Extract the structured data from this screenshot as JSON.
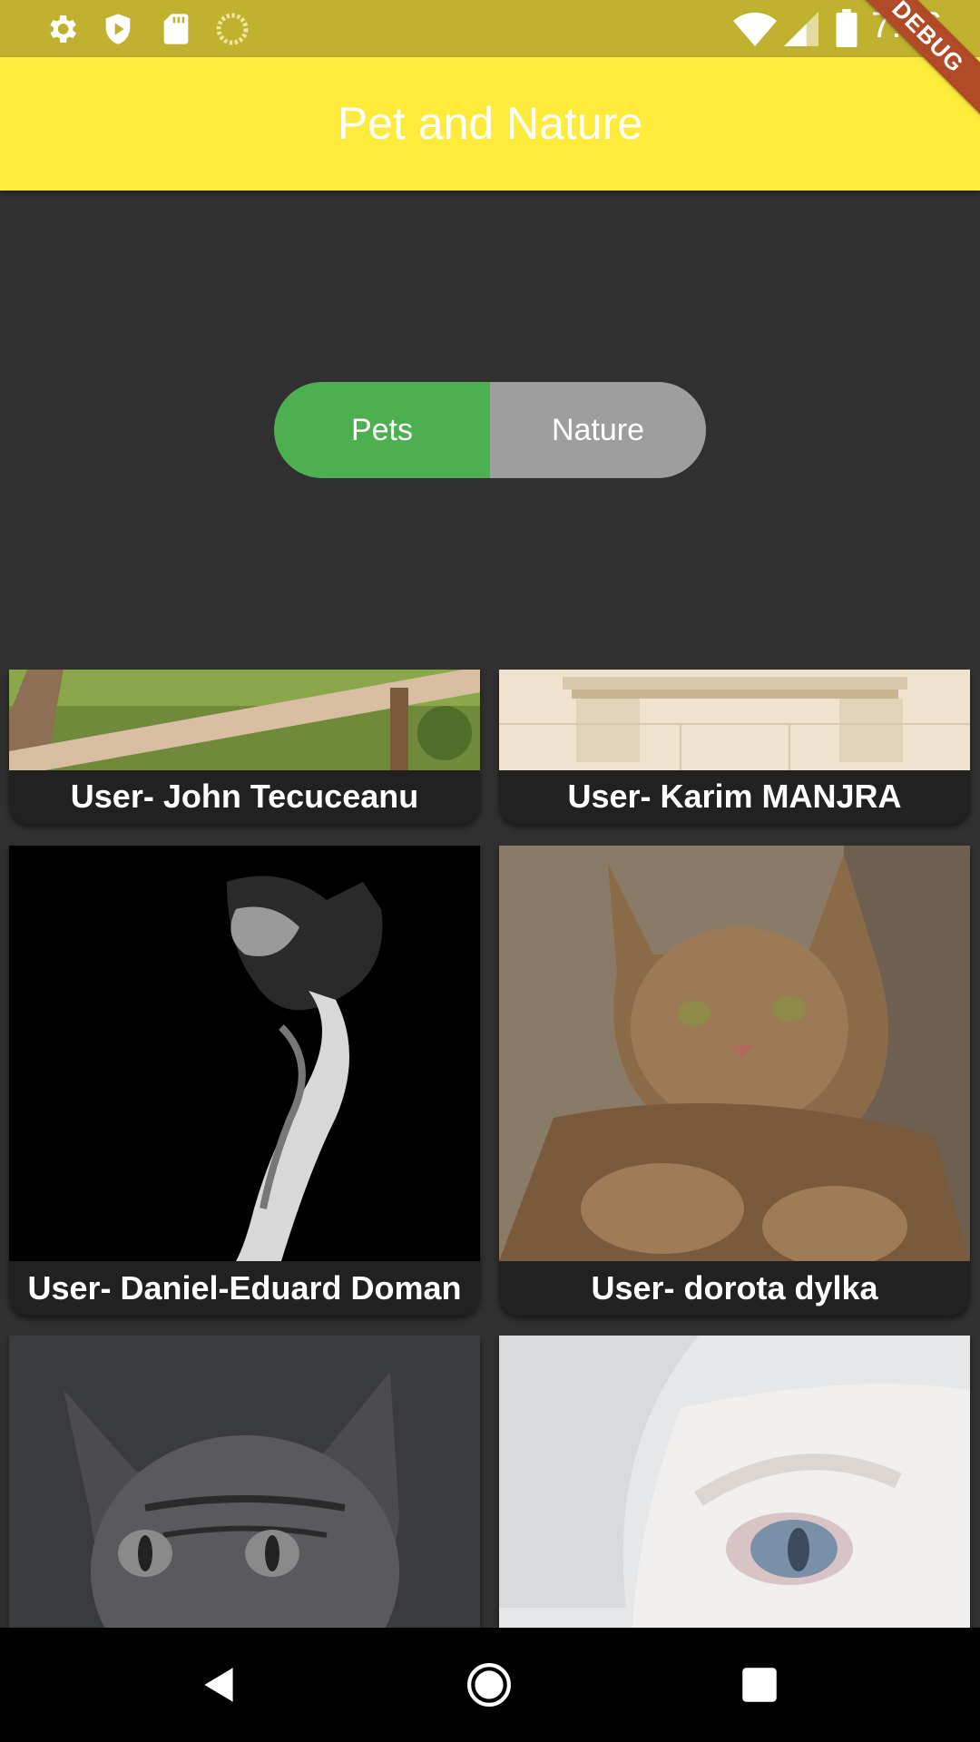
{
  "status_bar": {
    "time": "7:06",
    "left_icons": [
      "gear-icon",
      "shield-icon",
      "sd-card-icon",
      "loading-circle-icon"
    ],
    "right_icons": [
      "wifi-icon",
      "signal-icon",
      "battery-icon"
    ]
  },
  "app_bar": {
    "title": "Pet and Nature",
    "color": "#ffeb3b",
    "debug_banner": "DEBUG"
  },
  "segmented_toggle": {
    "options": [
      {
        "label": "Pets",
        "selected": true
      },
      {
        "label": "Nature",
        "selected": false
      }
    ],
    "active_color": "#4caf50",
    "inactive_color": "#9e9e9e"
  },
  "cards": [
    {
      "caption": "User- John Tecuceanu",
      "image": "wooden-fence-grass-photo"
    },
    {
      "caption": "User- Karim MANJRA",
      "image": "stone-building-cornice-photo"
    },
    {
      "caption": "User- Daniel-Eduard Doman",
      "image": "black-white-cat-in-shadow-photo"
    },
    {
      "caption": "User- dorota dylka",
      "image": "tabby-cat-lying-photo"
    },
    {
      "caption": "",
      "image": "grayscale-tabby-kitten-photo"
    },
    {
      "caption": "",
      "image": "white-cat-blue-eye-closeup-photo"
    }
  ],
  "nav_bar": {
    "icons": [
      "back-triangle-icon",
      "home-circle-icon",
      "recents-square-icon"
    ]
  }
}
